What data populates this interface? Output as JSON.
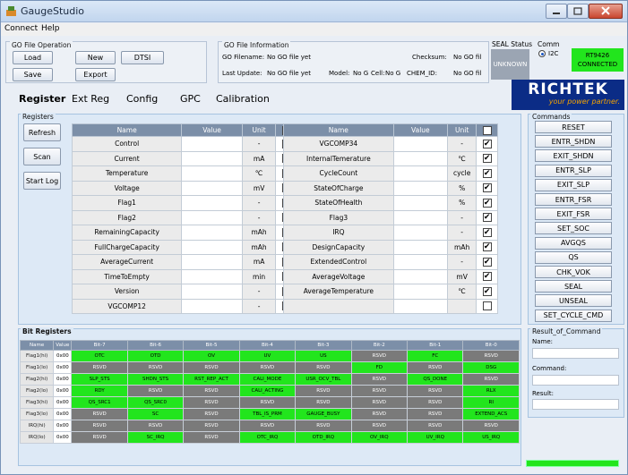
{
  "app": {
    "title": "GaugeStudio"
  },
  "menu": [
    "Connect",
    "Help"
  ],
  "gofile_op": {
    "caption": "GO File Operation",
    "load": "Load",
    "new": "New",
    "dtsi": "DTSI",
    "save": "Save",
    "export": "Export"
  },
  "gofile_info": {
    "caption": "GO File Information",
    "filename_label": "GO Filename:",
    "filename": "No GO file yet",
    "update_label": "Last Update:",
    "update": "No GO file yet",
    "model_label": "Model:",
    "model": "No G",
    "cell_label": "Cell:",
    "cell": "No G",
    "checksum_label": "Checksum:",
    "checksum": "No GO fil",
    "chemid_label": "CHEM_ID:",
    "chemid": "No GO fil"
  },
  "seal": {
    "caption": "SEAL Status",
    "value": "UNKNOWN"
  },
  "comm": {
    "caption": "Comm",
    "radio": "I2C",
    "status_line1": "RT9426",
    "status_line2": "CONNECTED"
  },
  "tabs": [
    "Register",
    "Ext Reg",
    "Config",
    "GPC",
    "Calibration"
  ],
  "logo": {
    "brand": "RICHTEK",
    "tagline": "your power partner."
  },
  "registers": {
    "caption": "Registers",
    "refresh": "Refresh",
    "scan": "Scan",
    "startlog": "Start Log",
    "headers": [
      "Name",
      "Value",
      "Unit"
    ],
    "left": [
      [
        "Control",
        "-",
        true
      ],
      [
        "Current",
        "mA",
        true
      ],
      [
        "Temperature",
        "℃",
        true
      ],
      [
        "Voltage",
        "mV",
        true
      ],
      [
        "Flag1",
        "-",
        true
      ],
      [
        "Flag2",
        "-",
        true
      ],
      [
        "RemainingCapacity",
        "mAh",
        true
      ],
      [
        "FullChargeCapacity",
        "mAh",
        true
      ],
      [
        "AverageCurrent",
        "mA",
        true
      ],
      [
        "TimeToEmpty",
        "min",
        true
      ],
      [
        "Version",
        "-",
        true
      ],
      [
        "VGCOMP12",
        "-",
        true
      ]
    ],
    "right": [
      [
        "VGCOMP34",
        "-",
        true
      ],
      [
        "InternalTemerature",
        "℃",
        true
      ],
      [
        "CycleCount",
        "cycle",
        true
      ],
      [
        "StateOfCharge",
        "%",
        true
      ],
      [
        "StateOfHealth",
        "%",
        true
      ],
      [
        "Flag3",
        "-",
        true
      ],
      [
        "IRQ",
        "-",
        true
      ],
      [
        "DesignCapacity",
        "mAh",
        true
      ],
      [
        "ExtendedControl",
        "-",
        true
      ],
      [
        "AverageVoltage",
        "mV",
        true
      ],
      [
        "AverageTemperature",
        "℃",
        true
      ],
      [
        "",
        "",
        false
      ]
    ]
  },
  "commands": {
    "caption": "Commands",
    "items": [
      "RESET",
      "ENTR_SHDN",
      "EXIT_SHDN",
      "ENTR_SLP",
      "EXIT_SLP",
      "ENTR_FSR",
      "EXIT_FSR",
      "SET_SOC",
      "AVGQS",
      "QS",
      "CHK_VOK",
      "SEAL",
      "UNSEAL",
      "SET_CYCLE_CMD"
    ]
  },
  "bits": {
    "caption": "Bit Registers",
    "headers": [
      "Name",
      "Value",
      "Bit-7",
      "Bit-6",
      "Bit-5",
      "Bit-4",
      "Bit-3",
      "Bit-2",
      "Bit-1",
      "Bit-0"
    ],
    "rows": [
      {
        "name": "Flag1(hi)",
        "value": "0x00",
        "bits": [
          [
            "OTC",
            1
          ],
          [
            "OTD",
            1
          ],
          [
            "OV",
            1
          ],
          [
            "UV",
            1
          ],
          [
            "US",
            1
          ],
          [
            "RSVD",
            0
          ],
          [
            "FC",
            1
          ],
          [
            "RSVD",
            0
          ]
        ]
      },
      {
        "name": "Flag1(lo)",
        "value": "0x00",
        "bits": [
          [
            "RSVD",
            0
          ],
          [
            "RSVD",
            0
          ],
          [
            "RSVD",
            0
          ],
          [
            "RSVD",
            0
          ],
          [
            "RSVD",
            0
          ],
          [
            "FD",
            1
          ],
          [
            "RSVD",
            0
          ],
          [
            "DSG",
            1
          ]
        ]
      },
      {
        "name": "Flag2(hi)",
        "value": "0x00",
        "bits": [
          [
            "SLP_STS",
            1
          ],
          [
            "SHDN_STS",
            1
          ],
          [
            "RST_REP_ACT",
            1
          ],
          [
            "CALI_MODE",
            1
          ],
          [
            "USR_OCV_TBL",
            1
          ],
          [
            "RSVD",
            0
          ],
          [
            "QS_DONE",
            1
          ],
          [
            "RSVD",
            0
          ]
        ]
      },
      {
        "name": "Flag2(lo)",
        "value": "0x00",
        "bits": [
          [
            "RDY",
            1
          ],
          [
            "RSVD",
            0
          ],
          [
            "RSVD",
            0
          ],
          [
            "CALI_ACTING",
            1
          ],
          [
            "RSVD",
            0
          ],
          [
            "RSVD",
            0
          ],
          [
            "RSVD",
            0
          ],
          [
            "RLX",
            1
          ]
        ]
      },
      {
        "name": "Flag3(hi)",
        "value": "0x00",
        "bits": [
          [
            "QS_SRC1",
            1
          ],
          [
            "QS_SRC0",
            1
          ],
          [
            "RSVD",
            0
          ],
          [
            "RSVD",
            0
          ],
          [
            "RSVD",
            0
          ],
          [
            "RSVD",
            0
          ],
          [
            "RSVD",
            0
          ],
          [
            "RI",
            1
          ]
        ]
      },
      {
        "name": "Flag3(lo)",
        "value": "0x00",
        "bits": [
          [
            "RSVD",
            0
          ],
          [
            "SC",
            1
          ],
          [
            "RSVD",
            0
          ],
          [
            "TBL_IS_PRM",
            1
          ],
          [
            "GAUGE_BUSY",
            1
          ],
          [
            "RSVD",
            0
          ],
          [
            "RSVD",
            0
          ],
          [
            "EXTEND_ACS",
            1
          ]
        ]
      },
      {
        "name": "IRQ(hi)",
        "value": "0x00",
        "bits": [
          [
            "RSVD",
            0
          ],
          [
            "RSVD",
            0
          ],
          [
            "RSVD",
            0
          ],
          [
            "RSVD",
            0
          ],
          [
            "RSVD",
            0
          ],
          [
            "RSVD",
            0
          ],
          [
            "RSVD",
            0
          ],
          [
            "RSVD",
            0
          ]
        ]
      },
      {
        "name": "IRQ(lo)",
        "value": "0x00",
        "bits": [
          [
            "RSVD",
            0
          ],
          [
            "SC_IRQ",
            1
          ],
          [
            "RSVD",
            0
          ],
          [
            "OTC_IRQ",
            1
          ],
          [
            "OTD_IRQ",
            1
          ],
          [
            "OV_IRQ",
            1
          ],
          [
            "UV_IRQ",
            1
          ],
          [
            "US_IRQ",
            1
          ]
        ]
      }
    ]
  },
  "result": {
    "caption": "Result_of_Command",
    "name_label": "Name:",
    "command_label": "Command:",
    "result_label": "Result:"
  },
  "colors": {
    "on": "#22e51d",
    "off": "#7a7a7a",
    "header": "#7c8fa8",
    "status": "#22e51d",
    "logo_bg": "#0b2c86",
    "tagline": "#f4a300"
  }
}
